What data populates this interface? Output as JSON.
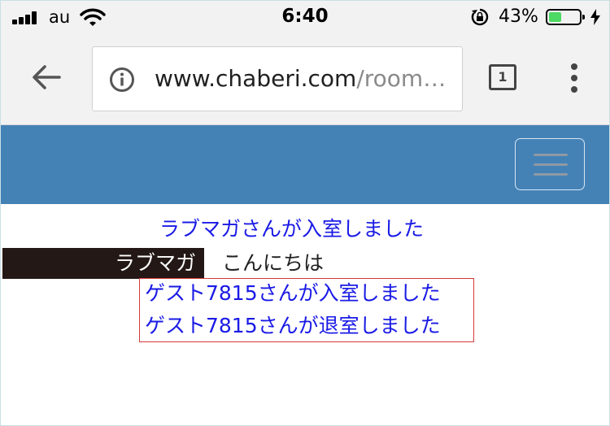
{
  "status_bar": {
    "carrier": "au",
    "time": "6:40",
    "battery_percent_text": "43%",
    "battery_level": 0.43,
    "icons": [
      "signal-bars-icon",
      "wifi-icon",
      "rotation-lock-icon",
      "battery-icon",
      "charging-bolt-icon"
    ]
  },
  "browser": {
    "url_domain": "www.chaberi.com",
    "url_path": "/room…",
    "tab_count": "1",
    "icons": [
      "back-arrow-icon",
      "info-icon",
      "tab-switcher-icon",
      "overflow-menu-icon"
    ]
  },
  "site": {
    "header_color": "#4482b6",
    "menu_icon": "hamburger-icon"
  },
  "chat": {
    "system_message_1": "ラブマガさんが入室しました",
    "user_name": "ラブマガ",
    "user_message": "こんにちは",
    "system_message_2": "ゲスト7815さんが入室しました",
    "system_message_3": "ゲスト7815さんが退室しました",
    "system_color": "#1a1ae6",
    "highlight_color": "#d63a3a"
  }
}
